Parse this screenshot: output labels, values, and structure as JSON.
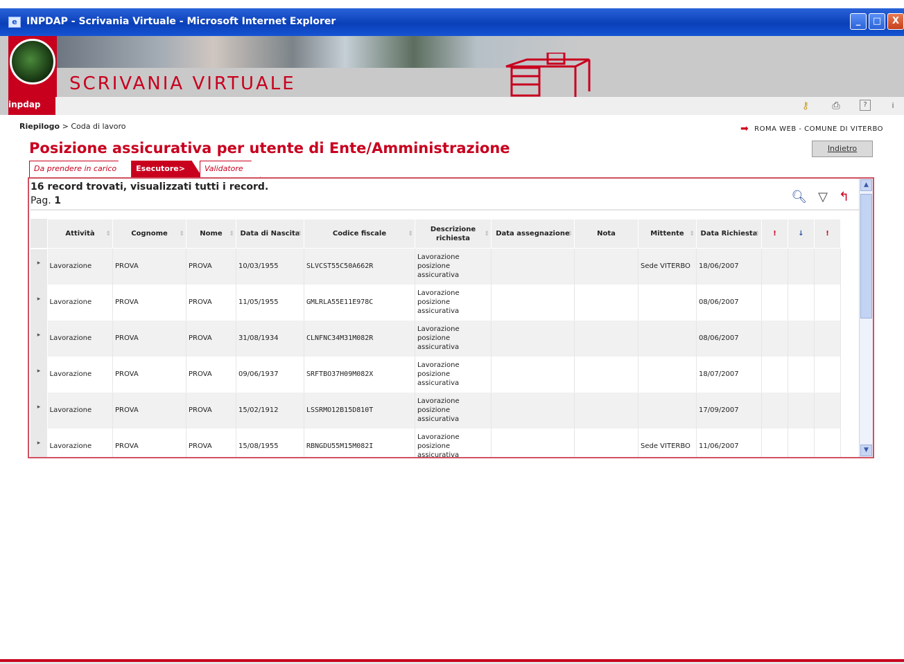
{
  "window": {
    "title": "INPDAP - Scrivania Virtuale - Microsoft Internet Explorer",
    "ie_icon": "ie-icon",
    "buttons": {
      "minimize": "_",
      "maximize": "□",
      "close": "X"
    }
  },
  "header": {
    "logo_text": "inpdap",
    "brand": "SCRIVANIA VIRTUALE",
    "toolbar_icons": [
      "key-icon",
      "print-icon",
      "help-icon",
      "info-icon"
    ]
  },
  "breadcrumb": {
    "root": "Riepilogo",
    "separator": ">",
    "current": "Coda di lavoro"
  },
  "location": {
    "arrow": "➡",
    "text": "ROMA WEB  - COMUNE DI VITERBO"
  },
  "page": {
    "title": "Posizione assicurativa per utente di Ente/Amministrazione",
    "back_button": "Indietro"
  },
  "tabs": [
    {
      "label": "Da prendere in carico",
      "active": false
    },
    {
      "label": "Esecutore>",
      "active": true
    },
    {
      "label": "Validatore",
      "active": false
    }
  ],
  "results": {
    "summary": "16 record trovati,  visualizzati tutti i record.",
    "page_label": "Pag.",
    "page_number": "1",
    "tools": [
      "search-icon",
      "filter-icon",
      "refresh-icon"
    ]
  },
  "table": {
    "columns": [
      "Attività",
      "Cognome",
      "Nome",
      "Data di Nascita",
      "Codice fiscale",
      "Descrizione richiesta",
      "Data assegnazione",
      "Nota",
      "Mittente",
      "Data Richiesta",
      "!",
      "↓",
      "!"
    ],
    "rows": [
      {
        "attivita": "Lavorazione",
        "cognome": "PROVA",
        "nome": "PROVA",
        "nascita": "10/03/1955",
        "cf": "SLVCST55C50A662R",
        "descr": "Lavorazione posizione assicurativa",
        "assegnazione": "",
        "nota": "",
        "mittente": "Sede VITERBO",
        "richiesta": "18/06/2007"
      },
      {
        "attivita": "Lavorazione",
        "cognome": "PROVA",
        "nome": "PROVA",
        "nascita": "11/05/1955",
        "cf": "GMLRLA55E11E978C",
        "descr": "Lavorazione posizione assicurativa",
        "assegnazione": "",
        "nota": "",
        "mittente": "",
        "richiesta": "08/06/2007"
      },
      {
        "attivita": "Lavorazione",
        "cognome": "PROVA",
        "nome": "PROVA",
        "nascita": "31/08/1934",
        "cf": "CLNFNC34M31M082R",
        "descr": "Lavorazione posizione assicurativa",
        "assegnazione": "",
        "nota": "",
        "mittente": "",
        "richiesta": "08/06/2007"
      },
      {
        "attivita": "Lavorazione",
        "cognome": "PROVA",
        "nome": "PROVA",
        "nascita": "09/06/1937",
        "cf": "SRFTBO37H09M082X",
        "descr": "Lavorazione posizione assicurativa",
        "assegnazione": "",
        "nota": "",
        "mittente": "",
        "richiesta": "18/07/2007"
      },
      {
        "attivita": "Lavorazione",
        "cognome": "PROVA",
        "nome": "PROVA",
        "nascita": "15/02/1912",
        "cf": "LSSRMO12B15D810T",
        "descr": "Lavorazione posizione assicurativa",
        "assegnazione": "",
        "nota": "",
        "mittente": "",
        "richiesta": "17/09/2007"
      },
      {
        "attivita": "Lavorazione",
        "cognome": "PROVA",
        "nome": "PROVA",
        "nascita": "15/08/1955",
        "cf": "RBNGDU55M15M082I",
        "descr": "Lavorazione posizione assicurativa",
        "assegnazione": "",
        "nota": "",
        "mittente": "Sede VITERBO",
        "richiesta": "11/06/2007"
      }
    ]
  },
  "colors": {
    "brand_red": "#c8001e",
    "title_bar": "#0a3fb8"
  }
}
